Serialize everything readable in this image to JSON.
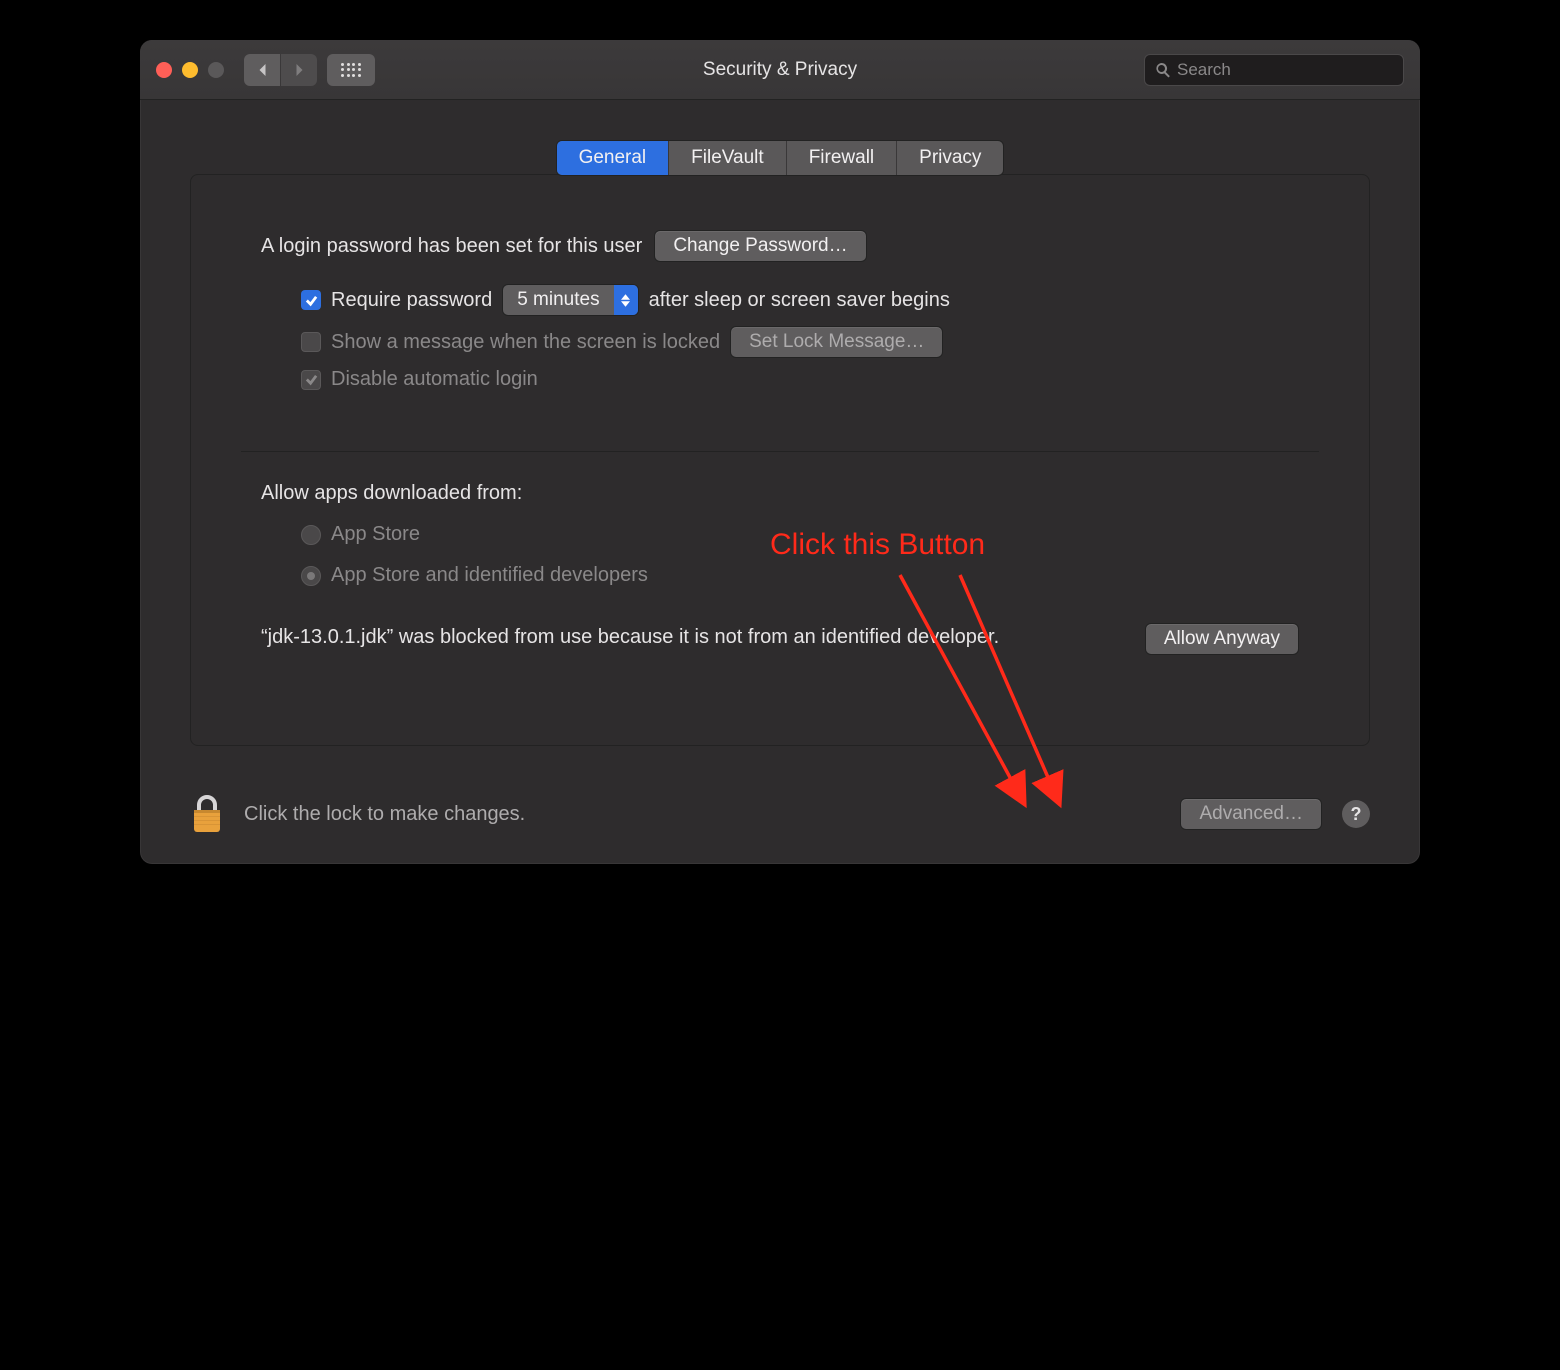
{
  "window": {
    "title": "Security & Privacy"
  },
  "search": {
    "placeholder": "Search"
  },
  "tabs": {
    "general": "General",
    "filevault": "FileVault",
    "firewall": "Firewall",
    "privacy": "Privacy",
    "active": "general"
  },
  "general": {
    "login_password_text": "A login password has been set for this user",
    "change_password_btn": "Change Password…",
    "require_password_label": "Require password",
    "require_password_delay": "5 minutes",
    "require_password_suffix": "after sleep or screen saver begins",
    "show_message_label": "Show a message when the screen is locked",
    "set_lock_message_btn": "Set Lock Message…",
    "disable_auto_login_label": "Disable automatic login",
    "allow_heading": "Allow apps downloaded from:",
    "radio_app_store": "App Store",
    "radio_identified": "App Store and identified developers",
    "blocked_text": "“jdk-13.0.1.jdk” was blocked from use because it is not from an identified developer.",
    "allow_anyway_btn": "Allow Anyway"
  },
  "footer": {
    "lock_text": "Click the lock to make changes.",
    "advanced_btn": "Advanced…",
    "help": "?"
  },
  "annotation": {
    "text": "Click this Button"
  }
}
